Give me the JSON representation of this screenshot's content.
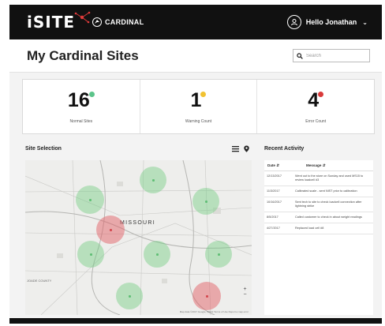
{
  "header": {
    "logo_text": "iSITE",
    "brand": "CARDINAL",
    "user_greeting": "Hello Jonathan"
  },
  "page": {
    "title": "My Cardinal Sites",
    "search_placeholder": "Search"
  },
  "stats": [
    {
      "value": "16",
      "label": "Normal Sites",
      "dot_color": "#5cc48a"
    },
    {
      "value": "1",
      "label": "Warning Count",
      "dot_color": "#f1c232"
    },
    {
      "value": "4",
      "label": "Error Count",
      "dot_color": "#d93a3a"
    }
  ],
  "site_selection": {
    "heading": "Site Selection",
    "map_region_label": "MISSOURI",
    "edge_label": "JOADE COUNTY",
    "zoom_in": "+",
    "zoom_out": "−",
    "attribution": "Map data ©2017 Google, INEGI   Terms of Use   Report a map error",
    "markers": [
      "normal",
      "normal",
      "normal",
      "error",
      "normal",
      "normal",
      "normal",
      "normal",
      "error"
    ]
  },
  "recent_activity": {
    "heading": "Recent Activity",
    "col_date": "Date",
    "col_message": "Message",
    "rows": [
      {
        "date": "12/13/2017",
        "message": "Went out to the store on Sunday and used MS15 to review loadcell #3"
      },
      {
        "date": "11/3/2017",
        "message": "Calibrated scale - sent NIST prior to calibration"
      },
      {
        "date": "10/16/2017",
        "message": "Sent tech to site to check loadcell connection after lightning strike"
      },
      {
        "date": "8/5/2017",
        "message": "Called customer to check in about weight readings"
      },
      {
        "date": "4/27/2017",
        "message": "Replaced load cell #8"
      }
    ]
  }
}
